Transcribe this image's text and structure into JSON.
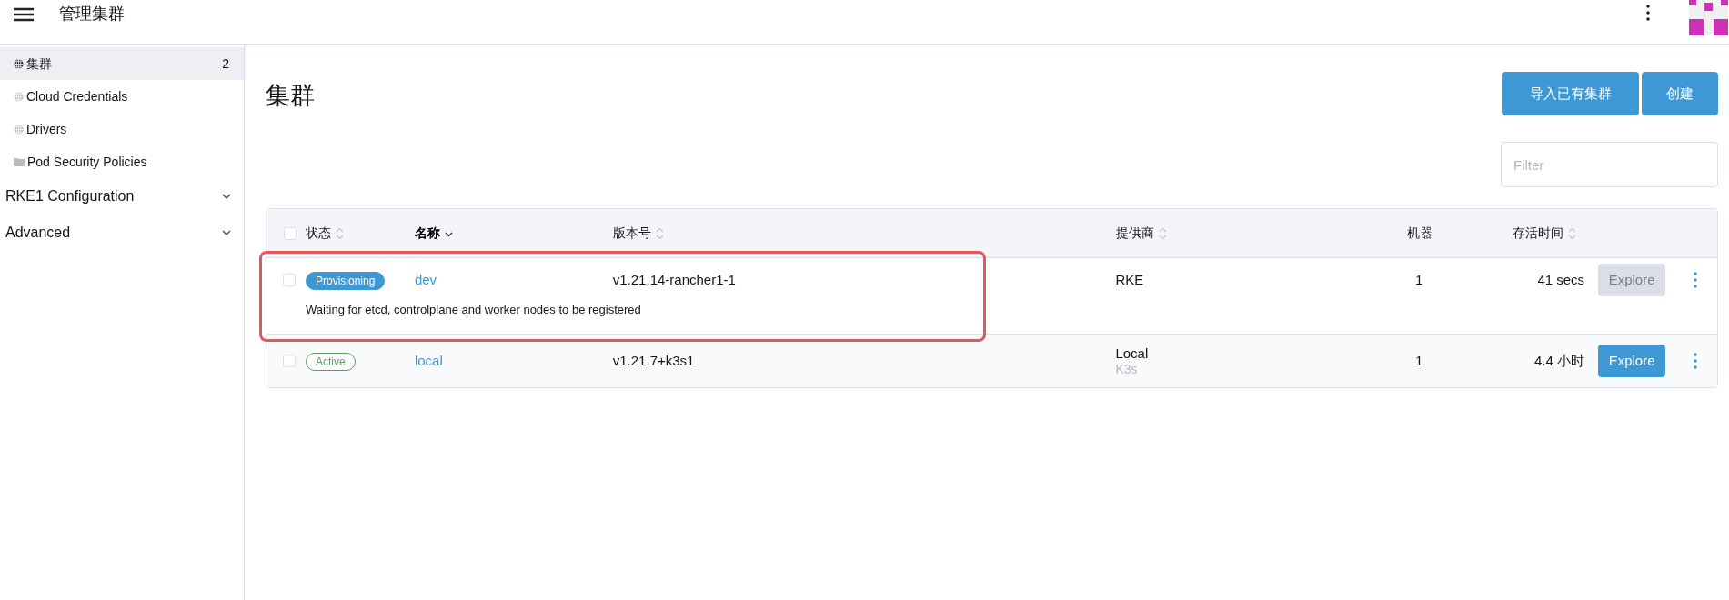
{
  "header": {
    "title": "管理集群"
  },
  "sidebar": {
    "items": [
      {
        "label": "集群",
        "kind": "globe",
        "count": "2",
        "selected": true
      },
      {
        "label": "Cloud Credentials",
        "kind": "globe",
        "selected": false
      },
      {
        "label": "Drivers",
        "kind": "globe",
        "selected": false
      },
      {
        "label": "Pod Security Policies",
        "kind": "folder",
        "selected": false
      }
    ],
    "groups": [
      {
        "label": "RKE1 Configuration",
        "expanded": false
      },
      {
        "label": "Advanced",
        "expanded": false
      }
    ]
  },
  "page": {
    "title": "集群",
    "buttons": [
      "导入已有集群",
      "创建"
    ],
    "filter": {
      "placeholder": "Filter"
    }
  },
  "table": {
    "all_checked": false,
    "columns": [
      {
        "label": "状态",
        "sortable": true,
        "sorted": false
      },
      {
        "label": "名称",
        "sortable": true,
        "sorted": true
      },
      {
        "label": "版本号",
        "sortable": true,
        "sorted": false
      },
      {
        "label": "提供商",
        "sortable": true,
        "sorted": false
      },
      {
        "label": "机器",
        "sortable": false,
        "sorted": false
      },
      {
        "label": "存活时间",
        "sortable": true,
        "sorted": false
      }
    ],
    "rows": [
      {
        "checked": false,
        "status": {
          "label": "Provisioning",
          "kind": "provisioning"
        },
        "name": "dev",
        "version": "v1.21.14-rancher1-1",
        "provider": "RKE",
        "machines": "1",
        "age": "41 secs",
        "action": {
          "label": "Explore",
          "disabled": true
        },
        "description": "Waiting for etcd, controlplane and worker nodes to be registered",
        "highlighted": true
      },
      {
        "checked": false,
        "status": {
          "label": "Active",
          "kind": "active"
        },
        "name": "local",
        "version": "v1.21.7+k3s1",
        "provider": "Local",
        "provider_detail": "K3s",
        "machines": "1",
        "age": "4.4 小时",
        "action": {
          "label": "Explore",
          "disabled": false
        },
        "highlighted": false
      }
    ]
  }
}
